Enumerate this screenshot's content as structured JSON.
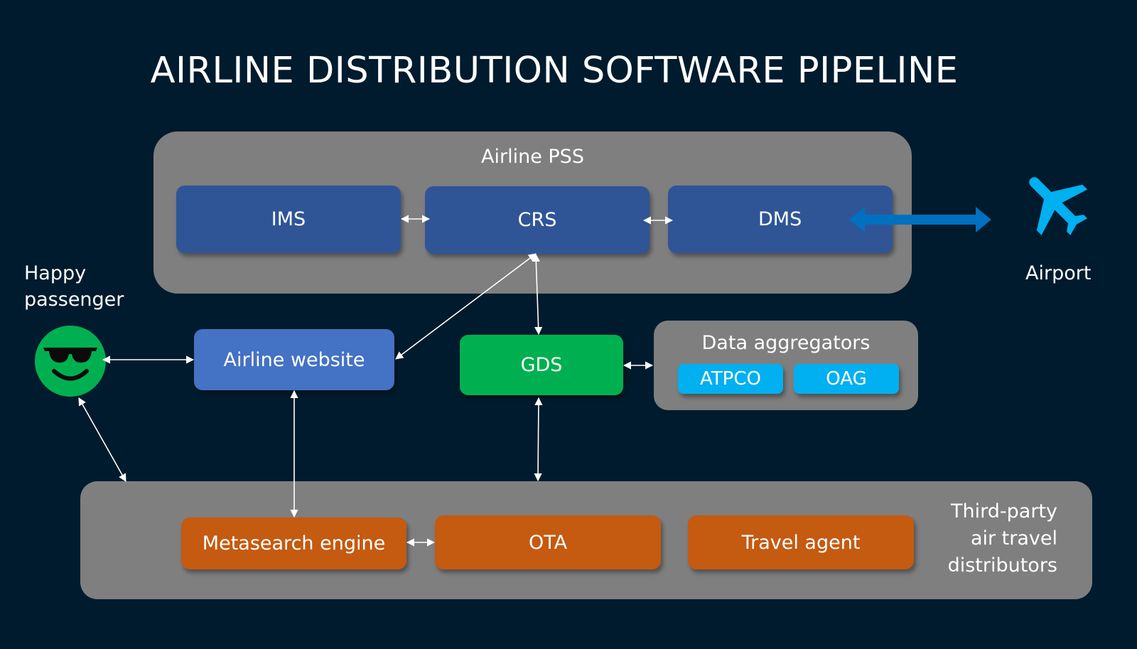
{
  "title": "AIRLINE DISTRIBUTION SOFTWARE PIPELINE",
  "pss": {
    "label": "Airline PSS",
    "ims": "IMS",
    "crs": "CRS",
    "dms": "DMS"
  },
  "airport": {
    "label": "Airport",
    "icon": "airplane-icon",
    "color": "#00b0f0"
  },
  "passenger": {
    "label_line1": "Happy",
    "label_line2": "passenger",
    "icon": "sunglasses-smiley-icon",
    "color": "#00b050"
  },
  "airline_website": "Airline website",
  "gds": "GDS",
  "aggregators": {
    "label": "Data aggregators",
    "atpco": "ATPCO",
    "oag": "OAG"
  },
  "distributors": {
    "label_line1": "Third-party",
    "label_line2": "air travel",
    "label_line3": "distributors",
    "metasearch": "Metasearch engine",
    "ota": "OTA",
    "travel_agent": "Travel agent"
  },
  "colors": {
    "background": "#001b2e",
    "group": "#7f7f7f",
    "pss_box": "#2f5597",
    "website_box": "#4472c4",
    "gds_box": "#00b050",
    "aggregator_box": "#00b0f0",
    "distributor_box": "#c55a11",
    "airport_arrow": "#0070c0"
  }
}
